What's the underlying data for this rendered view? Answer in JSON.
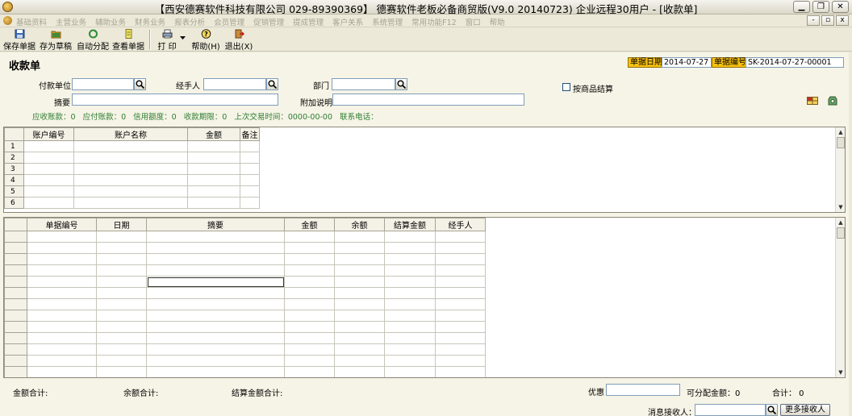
{
  "window": {
    "title": "【西安德赛软件科技有限公司 029-89390369】 德赛软件老板必备商贸版(V9.0 20140723) 企业远程30用户 - [收款单]",
    "minimize_glyph": "▁",
    "maximize_glyph": "❐",
    "close_glyph": "✕"
  },
  "menu": {
    "items": [
      "基础资料",
      "主营业务",
      "辅助业务",
      "财务业务",
      "报表分析",
      "会员管理",
      "促销管理",
      "提成管理",
      "客户关系",
      "系统管理",
      "常用功能F12",
      "窗口",
      "帮助"
    ],
    "mdi_minimize": "-",
    "mdi_restore": "▫",
    "mdi_close": "x"
  },
  "toolbar": {
    "save": "保存单据",
    "draft": "存为草稿",
    "auto_allocate": "自动分配",
    "view": "查看单据",
    "print": "打 印",
    "help": "帮助",
    "help_key": "(H)",
    "exit": "退出",
    "exit_key": "(X)"
  },
  "form": {
    "title": "收款单",
    "date_label": "单据日期",
    "date_value": "2014-07-27",
    "number_label": "单据编号",
    "number_value": "SK-2014-07-27-00001",
    "payer_label": "付款单位",
    "handler_label": "经手人",
    "dept_label": "部门",
    "summary_label": "摘要",
    "note_label": "附加说明",
    "checkbox_label": "按商品结算",
    "info": {
      "receivable": "应收账款：0",
      "payable": "应付账款：0",
      "credit": "信用额度：0",
      "term": "收款期限：0",
      "last_trade": "上次交易时间：0000-00-00",
      "phone": "联系电话："
    }
  },
  "account_table": {
    "headers": [
      "账户编号",
      "账户名称",
      "金额",
      "备注"
    ],
    "rows": [
      "1",
      "2",
      "3",
      "4",
      "5",
      "6"
    ]
  },
  "doc_table": {
    "headers": [
      "单据编号",
      "日期",
      "摘要",
      "金额",
      "余额",
      "结算金额",
      "经手人"
    ]
  },
  "footer": {
    "amount_total": "金额合计:",
    "balance_total": "余额合计:",
    "settle_total": "结算金额合计:",
    "discount_label": "优惠",
    "allocatable": "可分配金额：0",
    "total": "合计：  0",
    "receiver_label": "消息接收人：",
    "more_receivers": "更多接收人"
  }
}
